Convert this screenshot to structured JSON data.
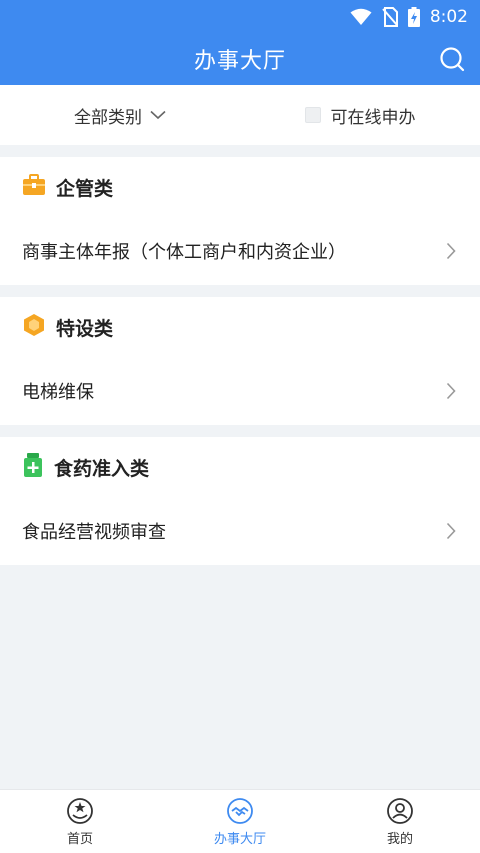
{
  "status_bar": {
    "time": "8:02",
    "icons": [
      "wifi-icon",
      "no-sim-icon",
      "battery-charging-icon"
    ]
  },
  "header": {
    "title": "办事大厅",
    "search_icon": "search-icon"
  },
  "filter": {
    "category_label": "全部类别",
    "online_label": "可在线申办",
    "online_checked": false
  },
  "sections": [
    {
      "title": "企管类",
      "icon": "briefcase-icon",
      "icon_color": "#f5a623",
      "items": [
        {
          "label": "商事主体年报（个体工商户和内资企业）"
        }
      ]
    },
    {
      "title": "特设类",
      "icon": "hexagon-icon",
      "icon_color": "#f5a623",
      "items": [
        {
          "label": "电梯维保"
        }
      ]
    },
    {
      "title": "食药准入类",
      "icon": "medicine-bottle-icon",
      "icon_color": "#3cc35c",
      "items": [
        {
          "label": "食品经营视频审查"
        }
      ]
    }
  ],
  "bottom_nav": {
    "items": [
      {
        "label": "首页",
        "icon": "home-emblem-icon",
        "active": false
      },
      {
        "label": "办事大厅",
        "icon": "handshake-icon",
        "active": true
      },
      {
        "label": "我的",
        "icon": "user-icon",
        "active": false
      }
    ],
    "active_color": "#3e8af0"
  },
  "colors": {
    "primary": "#3e8af0",
    "background": "#f0f3f6"
  }
}
